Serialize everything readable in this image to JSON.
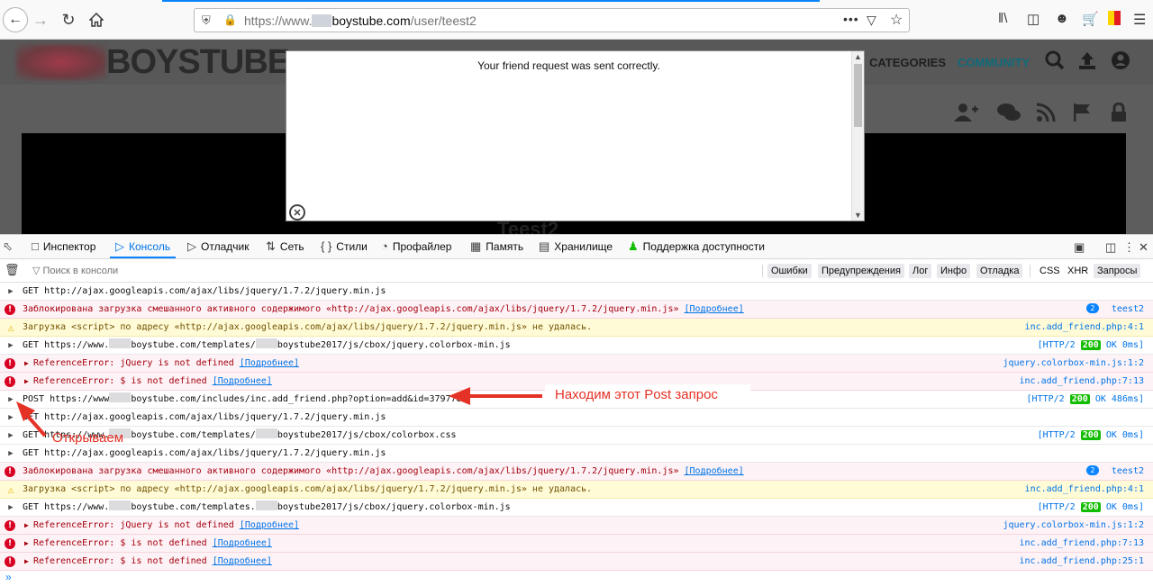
{
  "browser": {
    "url_prefix": "https://www.",
    "url_host": "boystube.com",
    "url_path": "/user/teest2"
  },
  "site": {
    "logo": "BOYSTUBE",
    "nav": [
      "CATEGORIES",
      "COMMUNITY"
    ],
    "user_title": "Teest2"
  },
  "modal": {
    "message": "Your friend request was sent correctly."
  },
  "devtools": {
    "tabs": [
      {
        "label": "Инспектор",
        "icon": "inspector-icon"
      },
      {
        "label": "Консоль",
        "icon": "console-icon"
      },
      {
        "label": "Отладчик",
        "icon": "debugger-icon"
      },
      {
        "label": "Сеть",
        "icon": "network-icon"
      },
      {
        "label": "Стили",
        "icon": "styles-icon"
      },
      {
        "label": "Профайлер",
        "icon": "profiler-icon"
      },
      {
        "label": "Память",
        "icon": "memory-icon"
      },
      {
        "label": "Хранилище",
        "icon": "storage-icon"
      },
      {
        "label": "Поддержка доступности",
        "icon": "accessibility-icon"
      }
    ],
    "active_tab": "Консоль",
    "filter_placeholder": "Поиск в консоли",
    "filters": [
      "Ошибки",
      "Предупреждения",
      "Лог",
      "Инфо",
      "Отладка",
      "CSS",
      "XHR",
      "Запросы"
    ],
    "rows": [
      {
        "type": "get",
        "text": "GET http://ajax.googleapis.com/ajax/libs/jquery/1.7.2/jquery.min.js"
      },
      {
        "type": "error",
        "text": "Заблокирована загрузка смешанного активного содержимого «http://ajax.googleapis.com/ajax/libs/jquery/1.7.2/jquery.min.js»",
        "link": "[Подробнее]",
        "badge": "2",
        "src": "teest2"
      },
      {
        "type": "warn",
        "text": "Загрузка <script> по адресу «http://ajax.googleapis.com/ajax/libs/jquery/1.7.2/jquery.min.js» не удалась.",
        "src": "inc.add_friend.php:4:1"
      },
      {
        "type": "get",
        "text_a": "GET https://www.",
        "text_b": "boystube.com/templates/",
        "text_c": "boystube2017/js/cbox/jquery.colorbox-min.js",
        "meta_a": "[HTTP/2",
        "status": "200",
        "meta_b": "OK 0ms]"
      },
      {
        "type": "error",
        "text": "ReferenceError: jQuery is not defined",
        "link": "[Подробнее]",
        "src": "jquery.colorbox-min.js:1:2"
      },
      {
        "type": "error",
        "text": "ReferenceError: $ is not defined",
        "link": "[Подробнее]",
        "src": "inc.add_friend.php:7:13"
      },
      {
        "type": "post",
        "text_a": "POST https://www",
        "text_b": "boystube.com/includes/inc.add_friend.php?option=add&id=379778",
        "meta_a": "[HTTP/2",
        "status": "200",
        "meta_b": "OK 486ms]"
      },
      {
        "type": "get",
        "text": "GET http://ajax.googleapis.com/ajax/libs/jquery/1.7.2/jquery.min.js"
      },
      {
        "type": "get",
        "text_a": "GET https://www.",
        "text_b": "boystube.com/templates/",
        "text_c": "boystube2017/js/cbox/colorbox.css",
        "meta_a": "[HTTP/2",
        "status": "200",
        "meta_b": "OK 0ms]"
      },
      {
        "type": "get",
        "text": "GET http://ajax.googleapis.com/ajax/libs/jquery/1.7.2/jquery.min.js"
      },
      {
        "type": "error",
        "text": "Заблокирована загрузка смешанного активного содержимого «http://ajax.googleapis.com/ajax/libs/jquery/1.7.2/jquery.min.js»",
        "link": "[Подробнее]",
        "badge": "2",
        "src": "teest2"
      },
      {
        "type": "warn",
        "text": "Загрузка <script> по адресу «http://ajax.googleapis.com/ajax/libs/jquery/1.7.2/jquery.min.js» не удалась.",
        "src": "inc.add_friend.php:4:1"
      },
      {
        "type": "get",
        "text_a": "GET https://www.",
        "text_b": "boystube.com/templates.",
        "text_c": "boystube2017/js/cbox/jquery.colorbox-min.js",
        "meta_a": "[HTTP/2",
        "status": "200",
        "meta_b": "OK 0ms]"
      },
      {
        "type": "error",
        "text": "ReferenceError: jQuery is not defined",
        "link": "[Подробнее]",
        "src": "jquery.colorbox-min.js:1:2"
      },
      {
        "type": "error",
        "text": "ReferenceError: $ is not defined",
        "link": "[Подробнее]",
        "src": "inc.add_friend.php:7:13"
      },
      {
        "type": "error",
        "text": "ReferenceError: $ is not defined",
        "link": "[Подробнее]",
        "src": "inc.add_friend.php:25:1"
      }
    ],
    "prompt": "»"
  },
  "annotations": {
    "post_note": "Находим этот Post запрос",
    "open_note": "Открываем"
  },
  "colors": {
    "accent": "#0a84ff",
    "error": "#d70022",
    "annotation": "#e53226",
    "status_ok": "#12bc00"
  }
}
